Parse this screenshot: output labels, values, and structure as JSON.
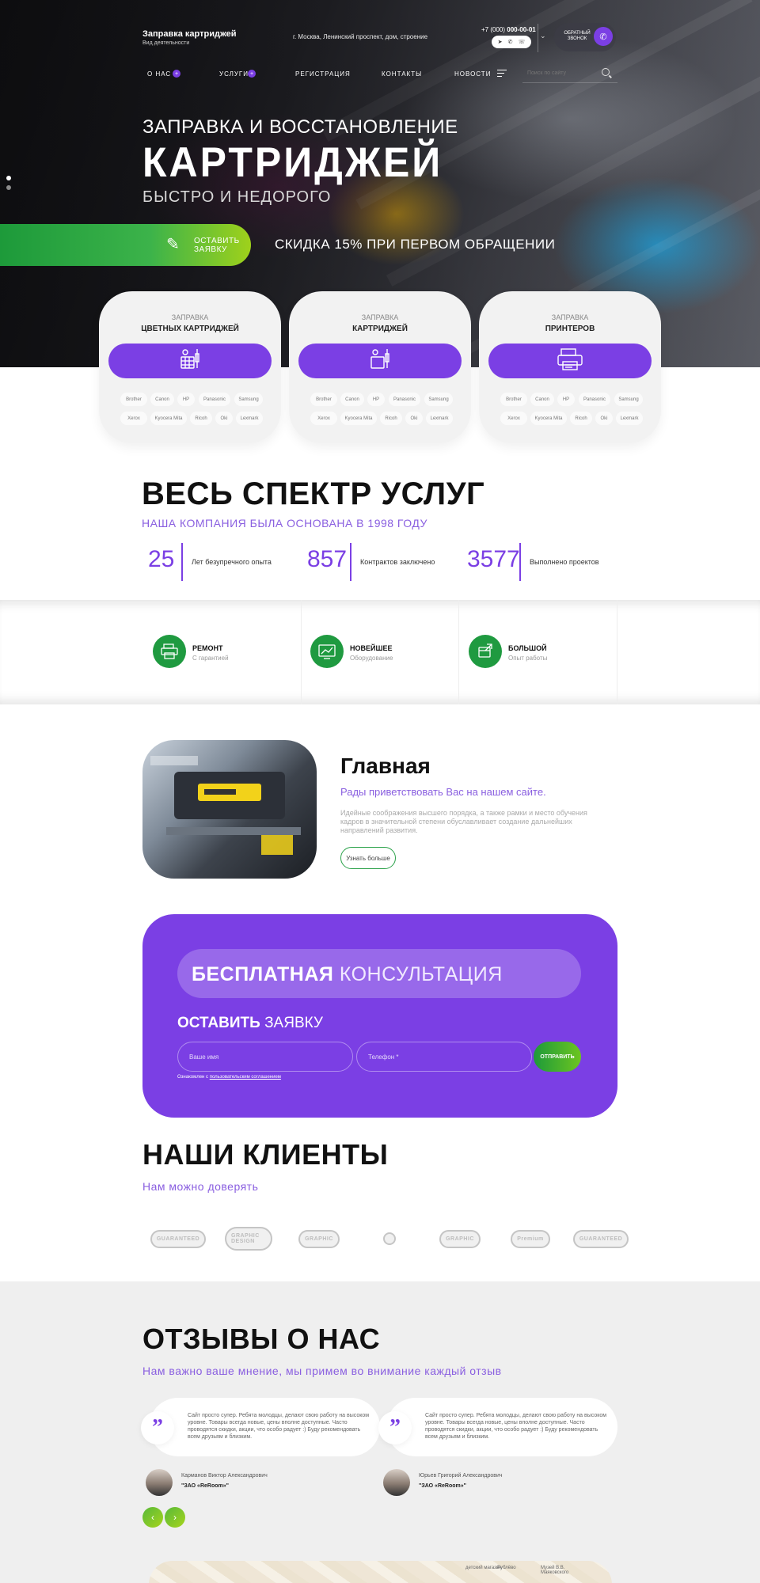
{
  "header": {
    "brand_name": "Заправка картриджей",
    "brand_sub": "Вид деятельности",
    "address": "г. Москва, Ленинский проспект, дом, строение",
    "phone_prefix": "+7 (000)",
    "phone_number": "000-00-01",
    "callback_label": "ОБРАТНЫЙ ЗВОНОК"
  },
  "nav": {
    "items": [
      {
        "label": "О НАС"
      },
      {
        "label": "УСЛУГИ"
      },
      {
        "label": "РЕГИСТРАЦИЯ"
      },
      {
        "label": "КОНТАКТЫ"
      },
      {
        "label": "НОВОСТИ"
      }
    ],
    "dot_symbol": "+",
    "search_placeholder": "Поиск по сайту"
  },
  "hero": {
    "line1": "ЗАПРАВКА И ВОССТАНОВЛЕНИЕ",
    "line2": "КАРТРИДЖЕЙ",
    "line3": "БЫСТРО И НЕДОРОГО",
    "cta_label": "ОСТАВИТЬ ЗАЯВКУ",
    "promo_bold": "СКИДКА 15%",
    "promo_rest": " ПРИ ПЕРВОМ ОБРАЩЕНИИ",
    "dot_colors": [
      "#ffffff",
      "#8c8c8c"
    ]
  },
  "service_cards": [
    {
      "caption": "ЗАПРАВКА",
      "title": "ЦВЕТНЫХ КАРТРИДЖЕЙ",
      "icon": "cartridge-color-icon"
    },
    {
      "caption": "ЗАПРАВКА",
      "title": "КАРТРИДЖЕЙ",
      "icon": "cartridge-icon"
    },
    {
      "caption": "ЗАПРАВКА",
      "title": "ПРИНТЕРОВ",
      "icon": "printer-icon"
    }
  ],
  "brands_row1": [
    "Brother",
    "Canon",
    "HP",
    "Panasonic",
    "Samsung"
  ],
  "brands_row2": [
    "Xerox",
    "Kyocera Mita",
    "Ricoh",
    "Oki",
    "Lexmark"
  ],
  "spectrum": {
    "title": "ВЕСЬ СПЕКТР УСЛУГ",
    "subtitle": "НАША КОМПАНИЯ БЫЛА ОСНОВАНА В 1998 ГОДУ",
    "stats": [
      {
        "value": "25",
        "label": "Лет безупречного опыта"
      },
      {
        "value": "857",
        "label": "Контрактов заключено"
      },
      {
        "value": "3577",
        "label": "Выполнено проектов"
      }
    ]
  },
  "features": [
    {
      "title": "РЕМОНТ",
      "sub": "С гарантией",
      "icon": "printer-repair-icon"
    },
    {
      "title": "НОВЕЙШЕЕ",
      "sub": "Оборудование",
      "icon": "equipment-icon"
    },
    {
      "title": "БОЛЬШОЙ",
      "sub": "Опыт работы",
      "icon": "experience-icon"
    }
  ],
  "about": {
    "title": "Главная",
    "lead": "Рады приветствовать Вас на нашем сайте.",
    "text": "Идейные соображения высшего порядка, а также рамки и место обучения кадров в значительной степени обуславливает создание дальнейших направлений развития.",
    "button": "Узнать больше"
  },
  "consult": {
    "title_bold": "БЕСПЛАТНАЯ",
    "title_rest": "КОНСУЛЬТАЦИЯ",
    "leave_bold": "ОСТАВИТЬ",
    "leave_rest": "ЗАЯВКУ",
    "name_placeholder": "Ваше имя",
    "phone_placeholder": "Телефон *",
    "send": "ОТПРАВИТЬ",
    "agree_prefix": "Ознакомлен с ",
    "agree_link": "пользовательским соглашением",
    "accent": "#7b3fe4"
  },
  "clients": {
    "title": "НАШИ КЛИЕНТЫ",
    "subtitle": "Нам можно доверять",
    "logos": [
      "GUARANTEED",
      "GRAPHIC DESIGN",
      "GRAPHIC",
      "",
      "GRAPHIC",
      "Premium",
      "GUARANTEED"
    ]
  },
  "reviews": {
    "title": "ОТЗЫВЫ О НАС",
    "subtitle": "Нам важно ваше мнение, мы примем во внимание каждый отзыв",
    "quote_mark": "”",
    "items": [
      {
        "text": "Сайт просто супер. Ребята молодцы, делают свою работу на высоком уровне. Товары всегда новые, цены вполне доступные. Часто проводятся скидки, акции, что особо радует :) Буду рекомендовать всем друзьям и близким.",
        "name": "Карманов Виктор Александрович",
        "company": "\"ЗАО «ReRoom»\""
      },
      {
        "text": "Сайт просто супер. Ребята молодцы, делают свою работу на высоком уровне. Товары всегда новые, цены вполне доступные. Часто проводятся скидки, акции, что особо радует :) Буду рекомендовать всем друзьям и близким.",
        "name": "Юрьев Григорий Александрович",
        "company": "\"ЗАО «ReRoom»\""
      }
    ],
    "prev": "‹",
    "next": "›"
  },
  "map": {
    "labels": [
      "детский магазин",
      "Рублёво",
      "Музей В.В. Маяковского"
    ]
  }
}
